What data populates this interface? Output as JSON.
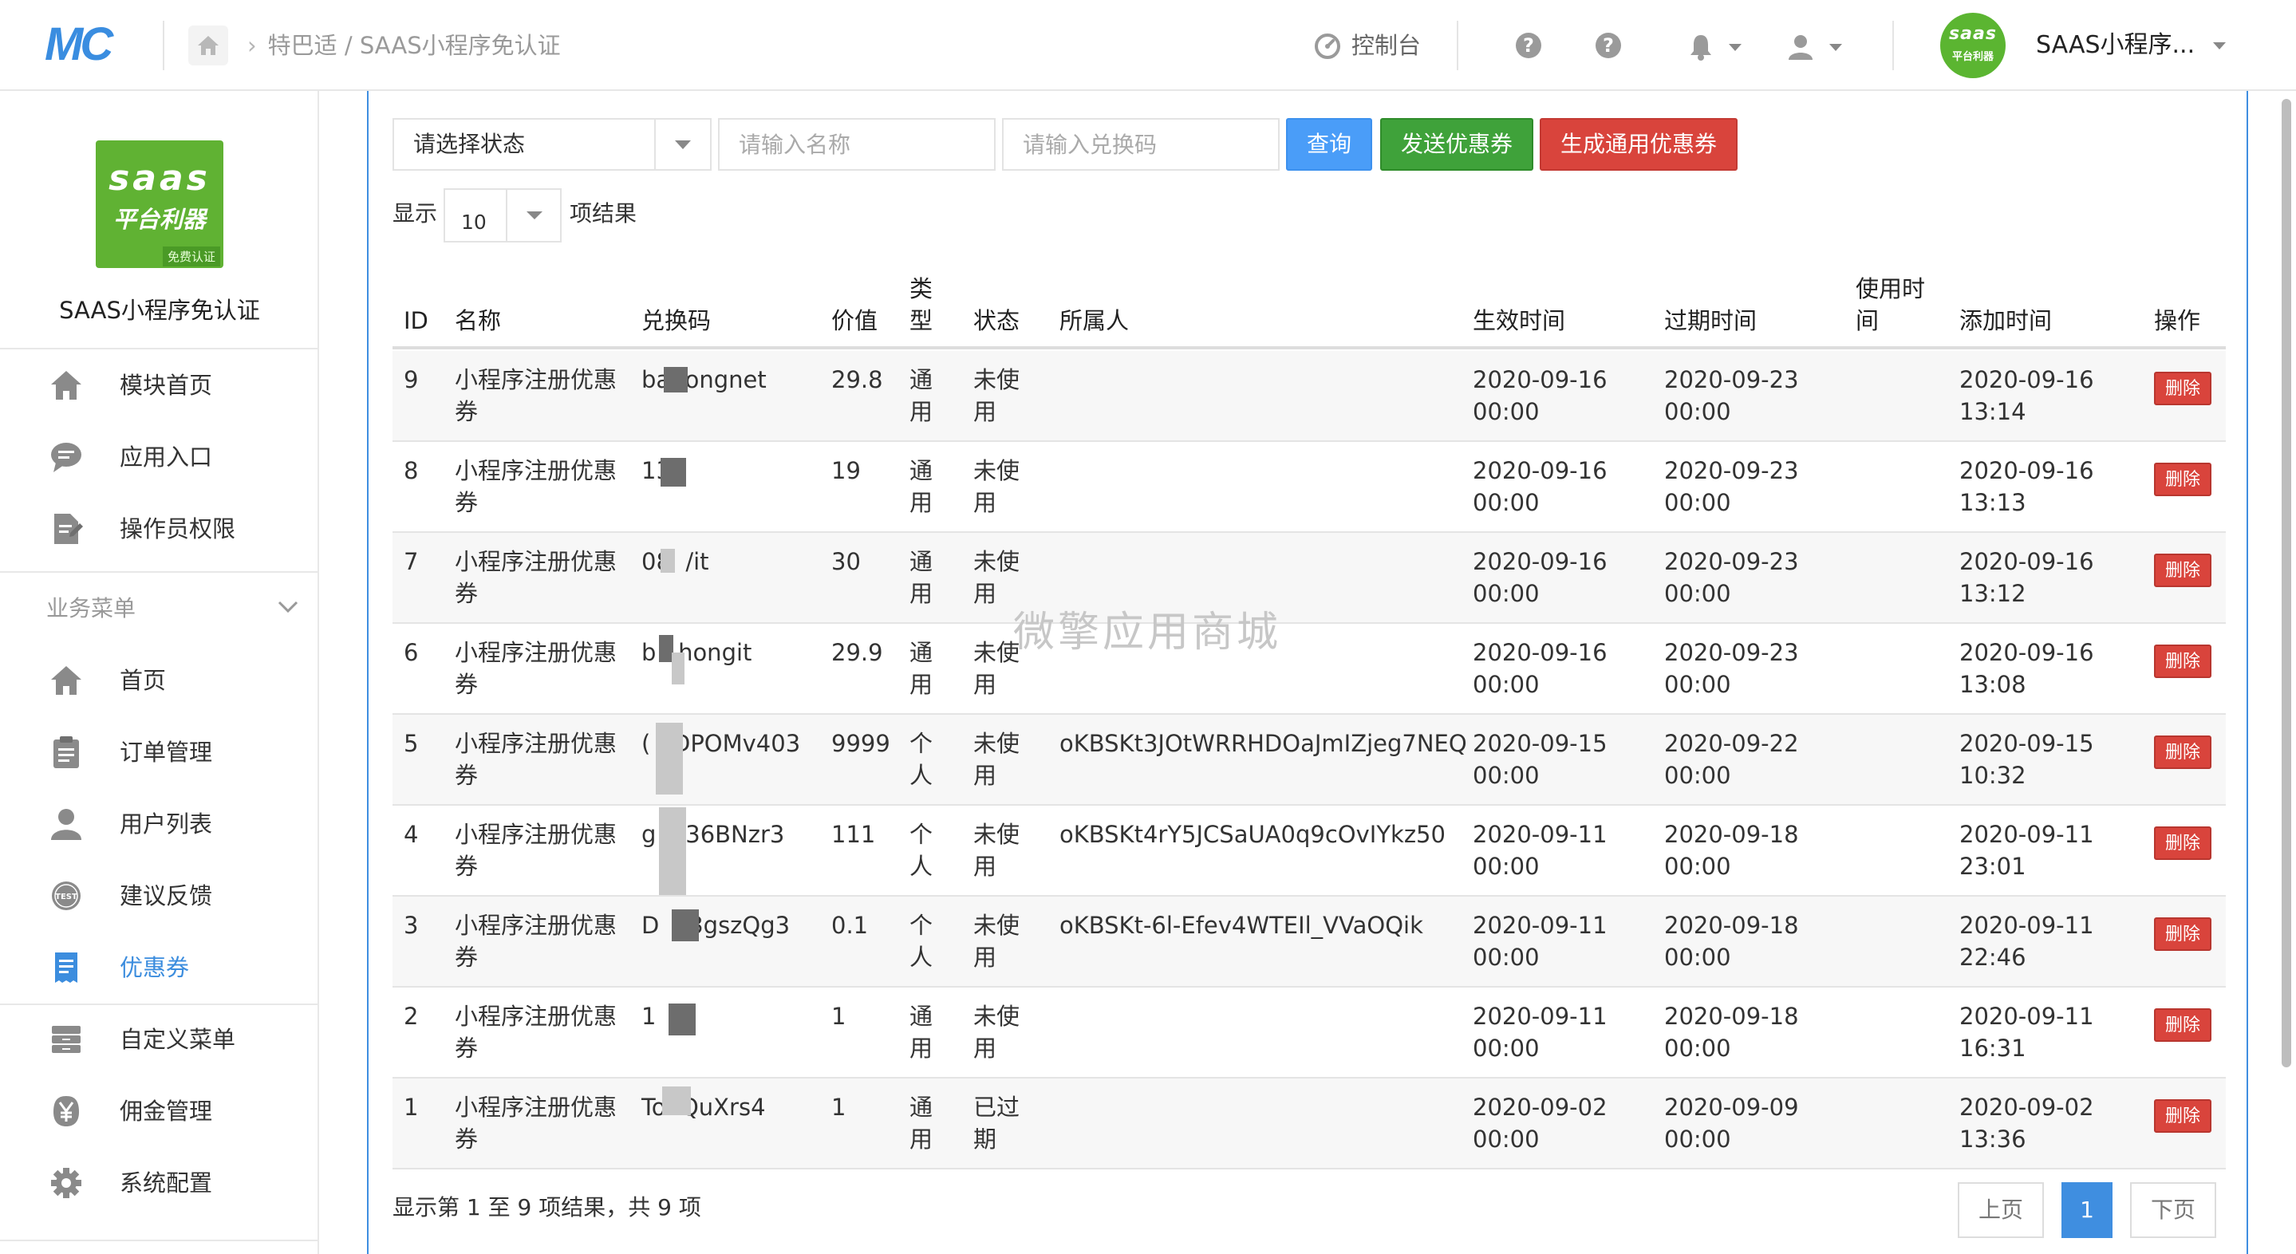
{
  "header": {
    "logo": "MC",
    "breadcrumb": [
      "特巴适",
      "SAAS小程序免认证"
    ],
    "console_label": "控制台",
    "avatar_line1": "saas",
    "avatar_line2": "平台利器",
    "user_name": "SAAS小程序..."
  },
  "sidebar": {
    "logo_line1": "saas",
    "logo_line2": "平台利器",
    "logo_badge": "免费认证",
    "app_name": "SAAS小程序免认证",
    "top_items": [
      {
        "label": "模块首页",
        "icon": "home-icon"
      },
      {
        "label": "应用入口",
        "icon": "chat-icon"
      },
      {
        "label": "操作员权限",
        "icon": "document-edit-icon"
      }
    ],
    "section_label": "业务菜单",
    "items": [
      {
        "label": "首页",
        "icon": "home-icon"
      },
      {
        "label": "订单管理",
        "icon": "clipboard-icon"
      },
      {
        "label": "用户列表",
        "icon": "user-icon"
      },
      {
        "label": "建议反馈",
        "icon": "test-badge-icon"
      },
      {
        "label": "优惠券",
        "icon": "receipt-icon",
        "active": true
      },
      {
        "label": "自定义菜单",
        "icon": "archive-icon"
      },
      {
        "label": "佣金管理",
        "icon": "yen-icon"
      },
      {
        "label": "系统配置",
        "icon": "gear-icon"
      }
    ]
  },
  "filters": {
    "status_select": "请选择状态",
    "name_placeholder": "请输入名称",
    "code_placeholder": "请输入兑换码",
    "query_button": "查询",
    "send_button": "发送优惠券",
    "generate_button": "生成通用优惠券",
    "show_label": "显示",
    "page_length": "10",
    "results_label": "项结果"
  },
  "table": {
    "headers": {
      "id": "ID",
      "name": "名称",
      "code": "兑换码",
      "value": "价值",
      "type": "类型",
      "status": "状态",
      "owner": "所属人",
      "start": "生效时间",
      "expire": "过期时间",
      "used": "使用时间",
      "added": "添加时间",
      "action": "操作"
    },
    "rows": [
      {
        "id": "9",
        "name": "小程序注册优惠券",
        "code": "ba  ongnet",
        "value": "29.8",
        "type": "通用",
        "status": "未使用",
        "owner": "",
        "start": [
          "2020-09-16",
          "00:00"
        ],
        "expire": [
          "2020-09-23",
          "00:00"
        ],
        "added": [
          "2020-09-16",
          "13:14"
        ],
        "action": "删除"
      },
      {
        "id": "8",
        "name": "小程序注册优惠券",
        "code": "13",
        "value": "19",
        "type": "通用",
        "status": "未使用",
        "owner": "",
        "start": [
          "2020-09-16",
          "00:00"
        ],
        "expire": [
          "2020-09-23",
          "00:00"
        ],
        "added": [
          "2020-09-16",
          "13:13"
        ],
        "action": "删除"
      },
      {
        "id": "7",
        "name": "小程序注册优惠券",
        "code": "08  /it",
        "value": "30",
        "type": "通用",
        "status": "未使用",
        "owner": "",
        "start": [
          "2020-09-16",
          "00:00"
        ],
        "expire": [
          "2020-09-23",
          "00:00"
        ],
        "added": [
          "2020-09-16",
          "13:12"
        ],
        "action": "删除"
      },
      {
        "id": "6",
        "name": "小程序注册优惠券",
        "code": "b   hongit",
        "value": "29.9",
        "type": "通用",
        "status": "未使用",
        "owner": "",
        "start": [
          "2020-09-16",
          "00:00"
        ],
        "expire": [
          "2020-09-23",
          "00:00"
        ],
        "added": [
          "2020-09-16",
          "13:08"
        ],
        "action": "删除"
      },
      {
        "id": "5",
        "name": "小程序注册优惠券",
        "code": "( 4DPOMv403",
        "value": "9999",
        "type": "个人",
        "status": "未使用",
        "owner": "oKBSKt3JOtWRRHDOaJmIZjeg7NEQ",
        "start": [
          "2020-09-15",
          "00:00"
        ],
        "expire": [
          "2020-09-22",
          "00:00"
        ],
        "added": [
          "2020-09-15",
          "10:32"
        ],
        "action": "删除"
      },
      {
        "id": "4",
        "name": "小程序注册优惠券",
        "code": "g  b36BNzr3",
        "value": "111",
        "type": "个人",
        "status": "未使用",
        "owner": "oKBSKt4rY5JCSaUA0q9cOvIYkz50",
        "start": [
          "2020-09-11",
          "00:00"
        ],
        "expire": [
          "2020-09-18",
          "00:00"
        ],
        "added": [
          "2020-09-11",
          "23:01"
        ],
        "action": "删除"
      },
      {
        "id": "3",
        "name": "小程序注册优惠券",
        "code": "D  53gszQg3",
        "value": "0.1",
        "type": "个人",
        "status": "未使用",
        "owner": "oKBSKt-6l-Efev4WTEIl_VVaOQik",
        "start": [
          "2020-09-11",
          "00:00"
        ],
        "expire": [
          "2020-09-18",
          "00:00"
        ],
        "added": [
          "2020-09-11",
          "22:46"
        ],
        "action": "删除"
      },
      {
        "id": "2",
        "name": "小程序注册优惠券",
        "code": "1",
        "value": "1",
        "type": "通用",
        "status": "未使用",
        "owner": "",
        "start": [
          "2020-09-11",
          "00:00"
        ],
        "expire": [
          "2020-09-18",
          "00:00"
        ],
        "added": [
          "2020-09-11",
          "16:31"
        ],
        "action": "删除"
      },
      {
        "id": "1",
        "name": "小程序注册优惠券",
        "code": "To  QuXrs4",
        "value": "1",
        "type": "通用",
        "status": "已过期",
        "owner": "",
        "start": [
          "2020-09-02",
          "00:00"
        ],
        "expire": [
          "2020-09-09",
          "00:00"
        ],
        "added": [
          "2020-09-02",
          "13:36"
        ],
        "action": "删除"
      }
    ]
  },
  "watermark": "微擎应用商城",
  "footer": {
    "info": "显示第 1 至 9 项结果，共 9 项",
    "prev": "上页",
    "current_page": "1",
    "next": "下页"
  },
  "colors": {
    "primary": "#3f8ee0",
    "success": "#3fa23a",
    "danger": "#d9443c",
    "brand_green": "#60b233"
  }
}
